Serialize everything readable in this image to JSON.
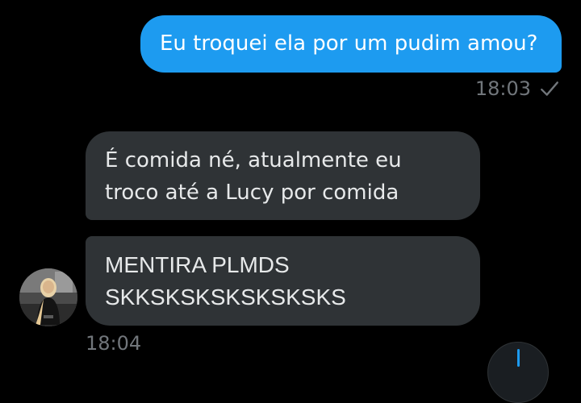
{
  "conversation": {
    "sent": [
      {
        "text": "Eu troquei ela por um pudim amou?",
        "time": "18:03",
        "status_icon": "check-icon"
      }
    ],
    "received": {
      "messages": [
        {
          "lines": [
            "É comida né, atualmente eu",
            "troco até a Lucy por comida"
          ]
        },
        {
          "lines": [
            "MENTIRA PLMDS",
            "SKKSKSKSKSKSKSKS"
          ]
        }
      ],
      "time": "18:04",
      "avatar_icon": "user-avatar"
    }
  },
  "fab": {
    "icon": "compose-icon"
  },
  "colors": {
    "background": "#000000",
    "sent_bubble": "#1d9bf0",
    "received_bubble": "#2f3336",
    "timestamp": "#71767b",
    "text_primary": "#e7e9ea"
  }
}
